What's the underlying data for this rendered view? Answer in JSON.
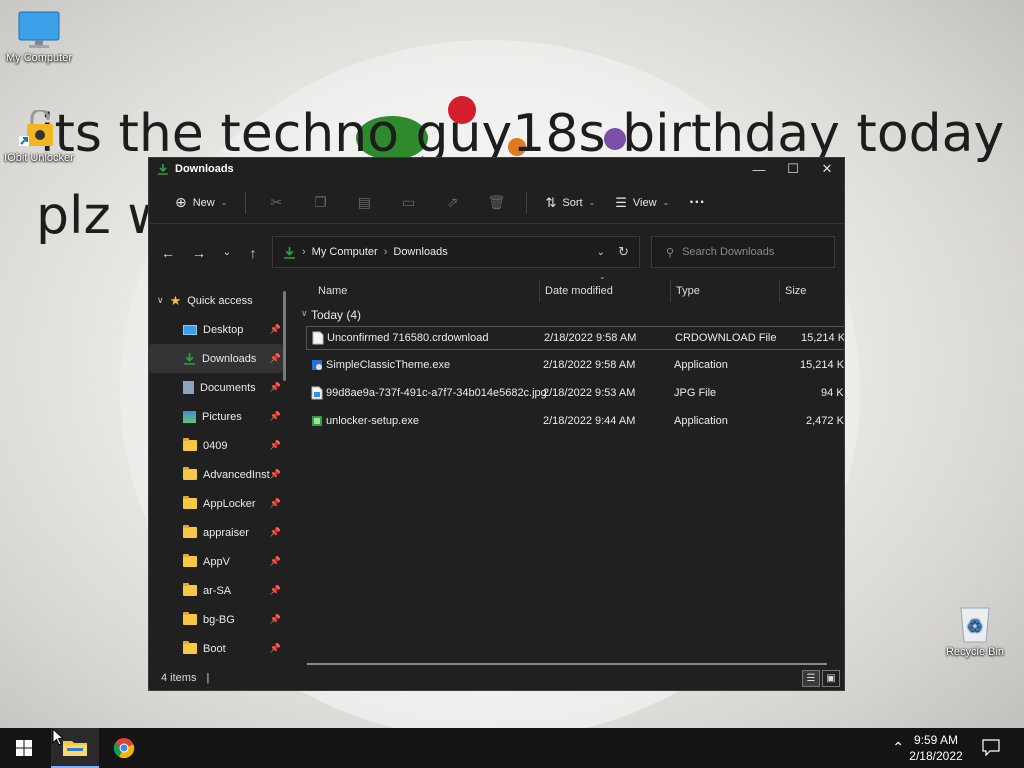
{
  "wallpaper": {
    "line1": "its the techno guy18s birthday today",
    "line2": "plz w"
  },
  "desktop": {
    "icons": [
      {
        "label": "My Computer"
      },
      {
        "label": "IObit Unlocker"
      },
      {
        "label": "Recycle Bin"
      }
    ]
  },
  "window": {
    "title": "Downloads",
    "controls": {
      "minimize": "—",
      "maximize": "☐",
      "close": "✕"
    },
    "toolbar": {
      "new_label": "New",
      "sort_label": "Sort",
      "view_label": "View",
      "more_label": "···"
    },
    "address": {
      "crumbs": [
        "My Computer",
        "Downloads"
      ],
      "separator": "›"
    },
    "search": {
      "placeholder": "Search Downloads"
    },
    "sidebar": {
      "quick_access": "Quick access",
      "items": [
        {
          "label": "Desktop",
          "icon": "desktop-icon"
        },
        {
          "label": "Downloads",
          "icon": "download-icon",
          "selected": true
        },
        {
          "label": "Documents",
          "icon": "document-icon"
        },
        {
          "label": "Pictures",
          "icon": "picture-icon"
        },
        {
          "label": "0409",
          "icon": "folder-icon"
        },
        {
          "label": "AdvancedInst",
          "icon": "folder-icon"
        },
        {
          "label": "AppLocker",
          "icon": "folder-icon"
        },
        {
          "label": "appraiser",
          "icon": "folder-icon"
        },
        {
          "label": "AppV",
          "icon": "folder-icon"
        },
        {
          "label": "ar-SA",
          "icon": "folder-icon"
        },
        {
          "label": "bg-BG",
          "icon": "folder-icon"
        },
        {
          "label": "Boot",
          "icon": "folder-icon"
        }
      ]
    },
    "columns": {
      "name": "Name",
      "date": "Date modified",
      "type": "Type",
      "size": "Size"
    },
    "group": {
      "label": "Today (4)"
    },
    "files": [
      {
        "name": "Unconfirmed 716580.crdownload",
        "date": "2/18/2022 9:58 AM",
        "type": "CRDOWNLOAD File",
        "size": "15,214 KB"
      },
      {
        "name": "SimpleClassicTheme.exe",
        "date": "2/18/2022 9:58 AM",
        "type": "Application",
        "size": "15,214 KB"
      },
      {
        "name": "99d8ae9a-737f-491c-a7f7-34b014e5682c.jpg",
        "date": "2/18/2022 9:53 AM",
        "type": "JPG File",
        "size": "94 KB"
      },
      {
        "name": "unlocker-setup.exe",
        "date": "2/18/2022 9:44 AM",
        "type": "Application",
        "size": "2,472 KB"
      }
    ],
    "status": {
      "count": "4 items",
      "divider": "|"
    }
  },
  "taskbar": {
    "time": "9:59 AM",
    "date": "2/18/2022"
  },
  "colors": {
    "accent": "#2ea043",
    "window_bg": "#202020",
    "taskbar_bg": "#141414",
    "folder": "#f7c843"
  }
}
